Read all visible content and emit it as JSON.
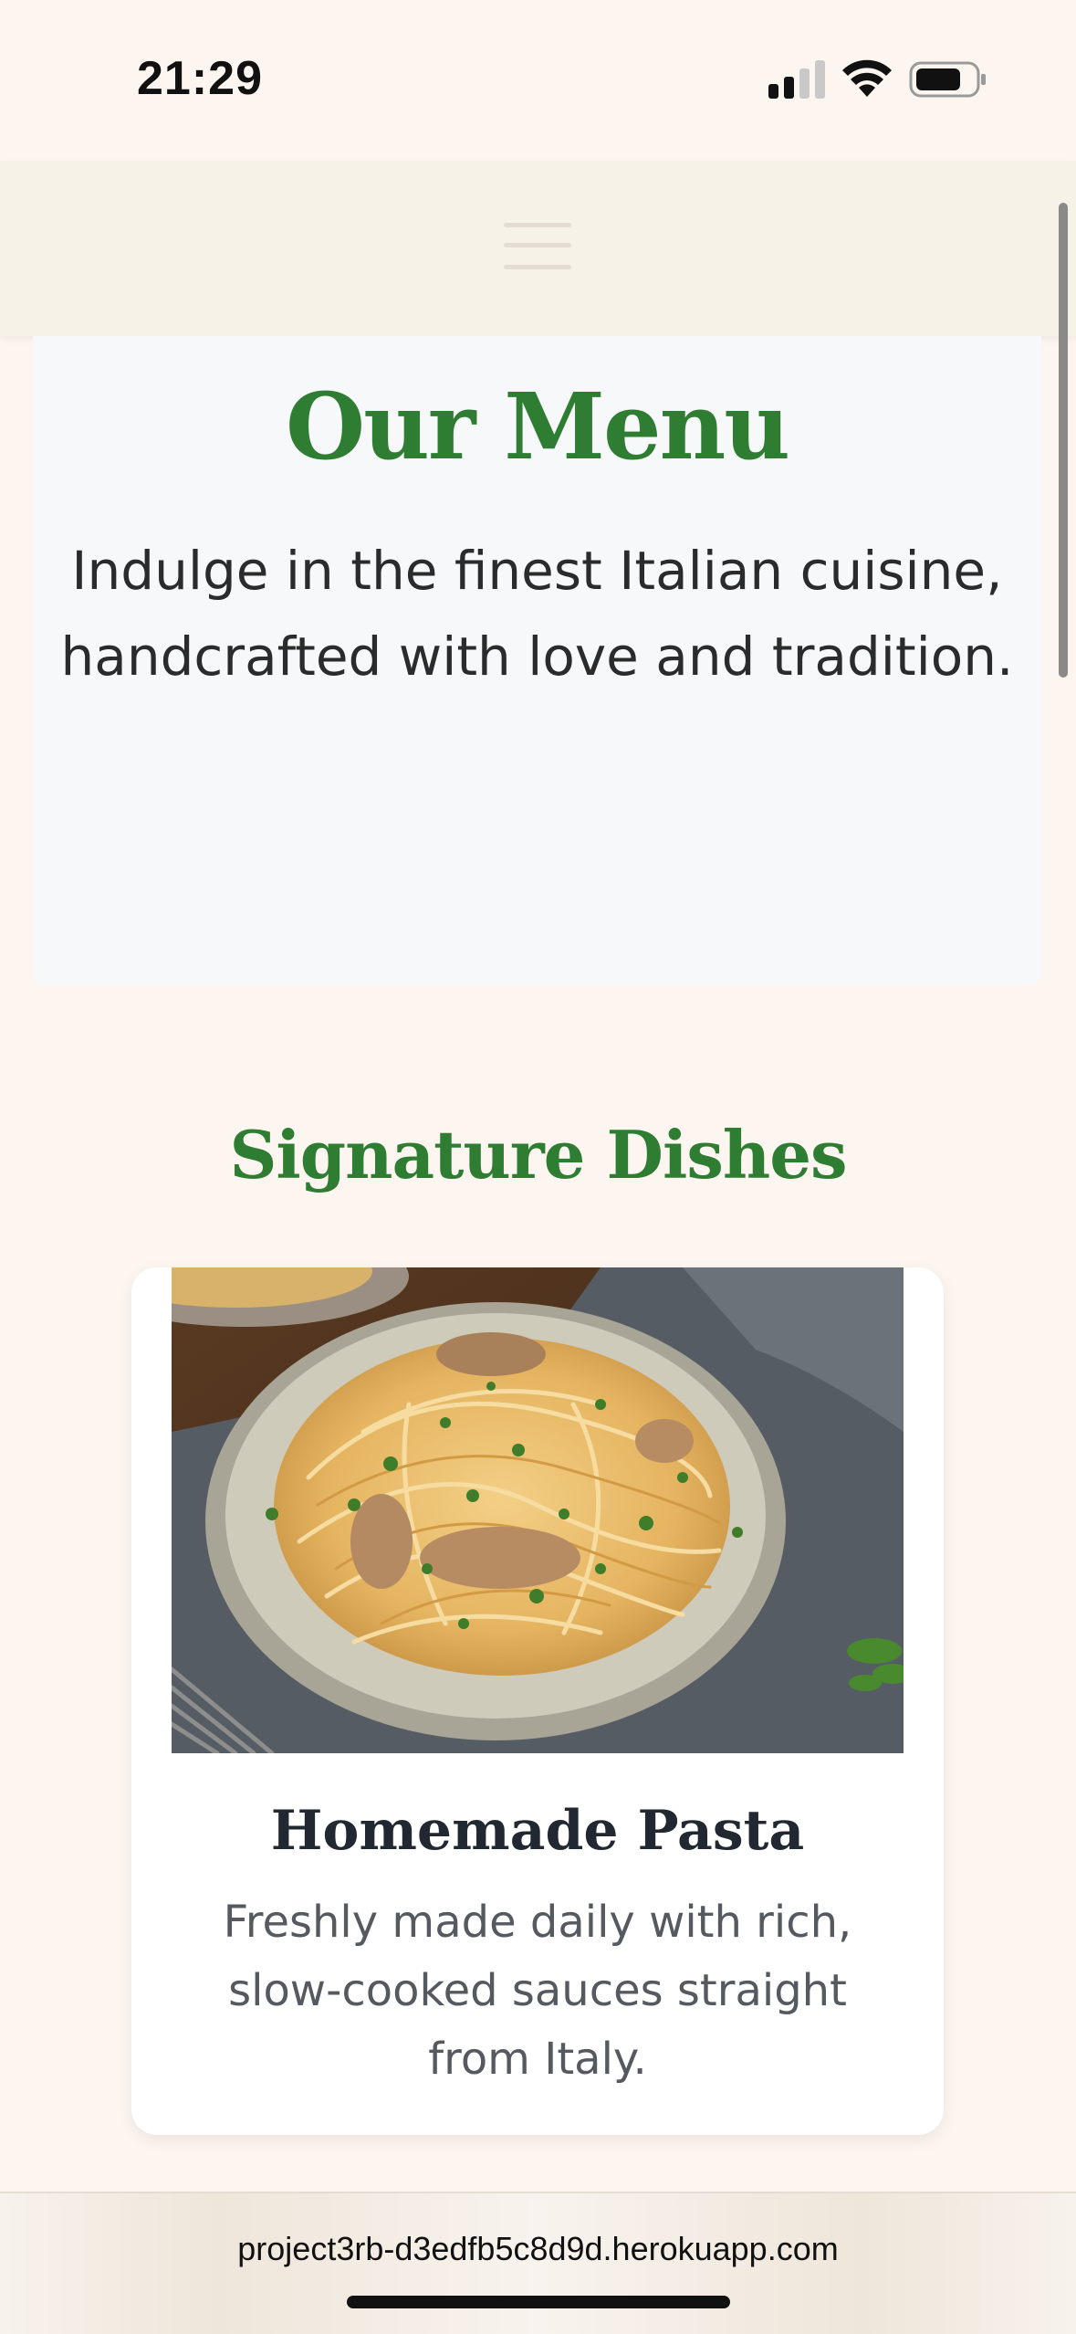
{
  "status_bar": {
    "time": "21:29",
    "icons": [
      "cellular-signal-icon",
      "wifi-icon",
      "battery-icon"
    ]
  },
  "navbar": {
    "menu_icon": "hamburger-menu-icon"
  },
  "hero": {
    "title": "Our Menu",
    "subtitle": "Indulge in the finest Italian cuisine, handcrafted with love and tradition."
  },
  "section": {
    "title": "Signature Dishes"
  },
  "dishes": [
    {
      "name": "Homemade Pasta",
      "description": "Freshly made daily with rich, slow-cooked sauces straight from Italy.",
      "image_icon": "pasta-plate-image"
    }
  ],
  "browser": {
    "url": "project3rb-d3edfb5c8d9d.herokuapp.com"
  },
  "colors": {
    "page_background": "#fdf6f0",
    "navbar_background": "#f6f2e7",
    "hero_background": "#f7f8fa",
    "accent_green": "#2e7d32",
    "card_background": "#ffffff"
  }
}
